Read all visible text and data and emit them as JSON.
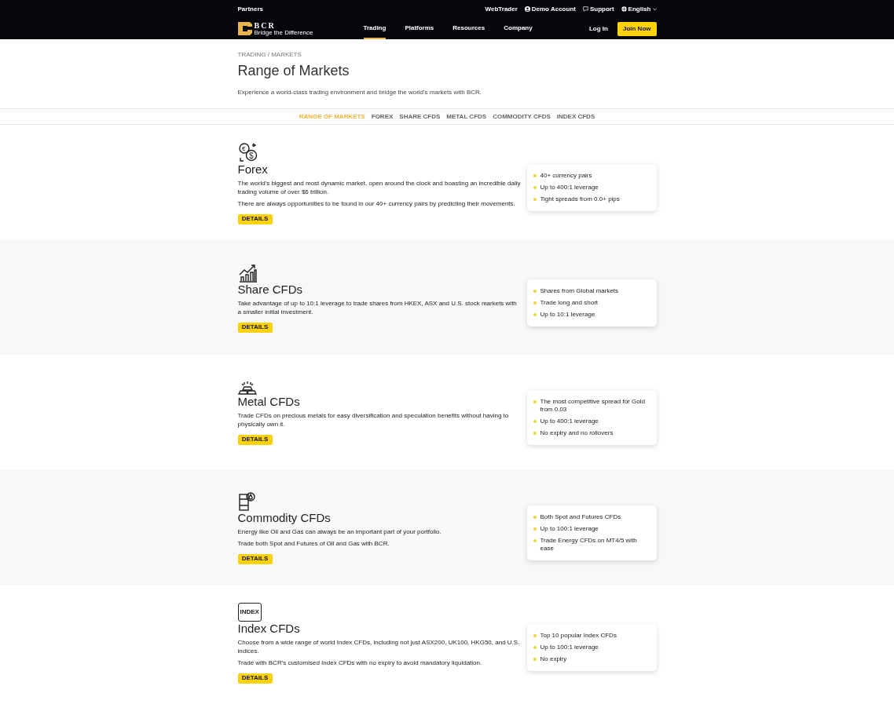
{
  "top_bar": {
    "left_link": "Partners",
    "links": [
      {
        "kind": "plain",
        "label": "WebTrader"
      },
      {
        "kind": "user",
        "label": "Demo Account"
      },
      {
        "kind": "chat",
        "label": "Support"
      },
      {
        "kind": "language",
        "label": "English"
      }
    ]
  },
  "nav": {
    "logo": {
      "text": "BCR",
      "tagline": "Bridge the Difference"
    },
    "items": [
      {
        "label": "Trading",
        "selected": true
      },
      {
        "label": "Platforms",
        "selected": false
      },
      {
        "label": "Resources",
        "selected": false
      },
      {
        "label": "Company",
        "selected": false
      }
    ],
    "login": "Log In",
    "join": "Join Now"
  },
  "breadcrumb": "TRADING / MARKETS",
  "title": "Range of Markets",
  "intro": "Experience a world-class trading environment and bridge the world's markets with BCR.",
  "subnav": [
    {
      "label": "RANGE OF MARKETS",
      "selected": true
    },
    {
      "label": "FOREX",
      "selected": false
    },
    {
      "label": "SHARE CFDS",
      "selected": false
    },
    {
      "label": "METAL CFDS",
      "selected": false
    },
    {
      "label": "COMMODITY CFDS",
      "selected": false
    },
    {
      "label": "INDEX CFDS",
      "selected": false
    }
  ],
  "markets": [
    {
      "kind": "forex",
      "icon_symbols": [
        "€",
        "$"
      ],
      "title": "Forex",
      "paragraphs": [
        "The world's biggest and most dynamic market, open around the clock and boasting an incredible daily trading volume of over $6 trillion.",
        "There are always opportunities to be found in our 40+ currency pairs by predicting their movements."
      ],
      "button": "DETAILS",
      "features": [
        "40+ currency pairs",
        "Up to 400:1 leverage",
        "Tight spreads from 0.0+ pips"
      ]
    },
    {
      "kind": "share",
      "title": "Share CFDs",
      "paragraphs": [
        "Take advantage of up to 10:1 leverage to trade shares from HKEX, ASX and U.S. stock markets with a smaller initial investment."
      ],
      "button": "DETAILS",
      "features": [
        "Shares from Global markets",
        "Trade long and short",
        "Up to 10:1 leverage"
      ]
    },
    {
      "kind": "metal",
      "title": "Metal CFDs",
      "paragraphs": [
        "Trade CFDs on precious metals for easy diversification and speculation benefits without having to physically own it."
      ],
      "button": "DETAILS",
      "features": [
        "The most competitive spread for Gold from 0.03",
        "Up to 400:1 leverage",
        "No expiry and no rollovers"
      ]
    },
    {
      "kind": "commodity",
      "title": "Commodity CFDs",
      "paragraphs": [
        "Energy like Oil and Gas can always be an important part of your portfolio.",
        "Trade both Spot and Futures of Oil and Gas with BCR."
      ],
      "button": "DETAILS",
      "features": [
        "Both Spot and Futures CFDs",
        "Up to 100:1 leverage",
        "Trade Energy CFDs on MT4/5 with ease"
      ]
    },
    {
      "kind": "index",
      "icon_text": "INDEX",
      "title": "Index CFDs",
      "paragraphs": [
        "Choose from a wide range of world Index CFDs, including not just ASX200, UK100, HKG50, and U.S. indices.",
        "Trade with BCR's customised Index CFDs with no expiry to avoid mandatory liquidation."
      ],
      "button": "DETAILS",
      "features": [
        "Top 10 popular Index CFDs",
        "Up to 100:1 leverage",
        "No expiry"
      ]
    }
  ]
}
